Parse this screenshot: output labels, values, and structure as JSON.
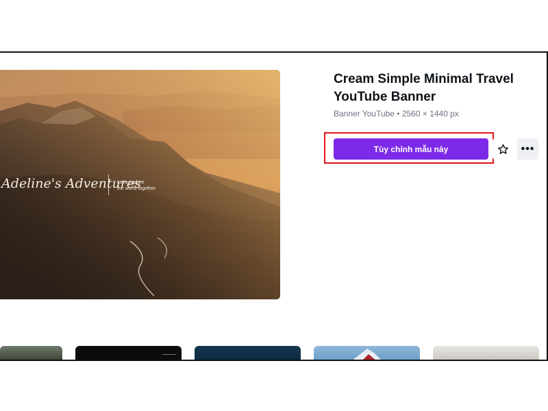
{
  "template": {
    "title": "Cream Simple Minimal Travel YouTube Banner",
    "meta": "Banner YouTube • 2560 × 1440 px"
  },
  "actions": {
    "customize_label": "Tùy chỉnh mẫu này",
    "favorite_icon": "star-icon",
    "more_icon": "more-horizontal-icon",
    "accent_color": "#7d2ae8",
    "highlight_color": "#e0121a"
  },
  "preview": {
    "script_text": "Adeline's Adventures",
    "tagline_line1": "Let's explore",
    "tagline_line2": "the world together"
  },
  "related_thumbnails": [
    "mountain-forest",
    "dark-poster",
    "night-sky",
    "snowy-peak",
    "misty-landscape"
  ]
}
